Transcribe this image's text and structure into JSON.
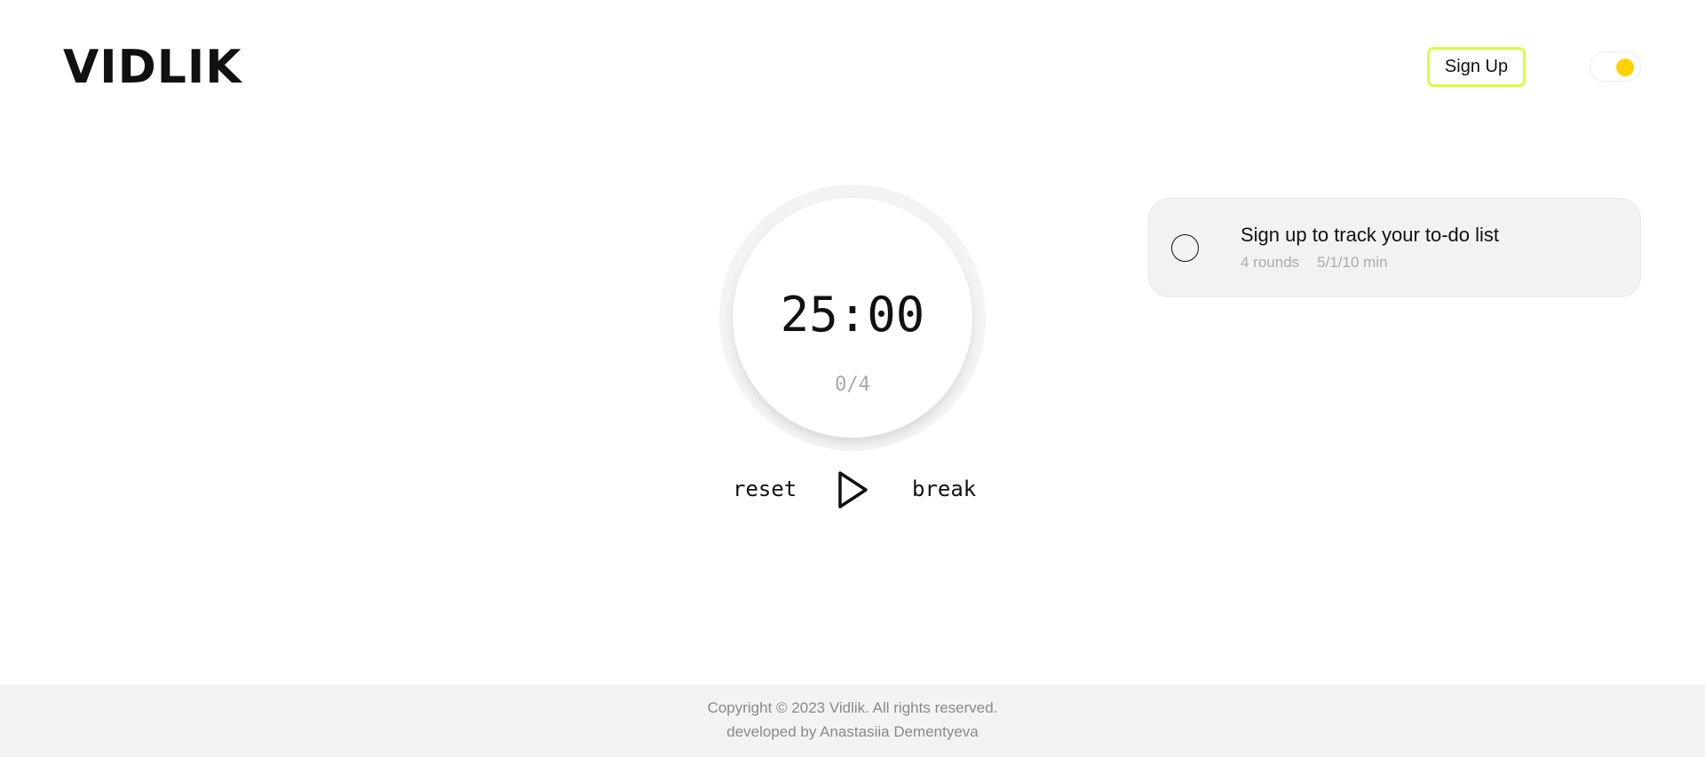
{
  "header": {
    "logo": "VIDLIK",
    "signup_label": "Sign Up",
    "theme_toggle_icon": "sun-toggle-icon",
    "accent_color": "#d7ff3d",
    "toggle_color": "#ffd200"
  },
  "timer": {
    "time": "25:00",
    "rounds": "0/4",
    "reset_label": "reset",
    "break_label": "break",
    "play_icon": "play-icon"
  },
  "task": {
    "title": "Sign up to track your to-do list",
    "rounds": "4 rounds",
    "durations": "5/1/10 min",
    "checked": false
  },
  "footer": {
    "copyright": "Copyright © 2023 Vidlik. All rights reserved.",
    "developer": "developed by Anastasiia Dementyeva"
  }
}
